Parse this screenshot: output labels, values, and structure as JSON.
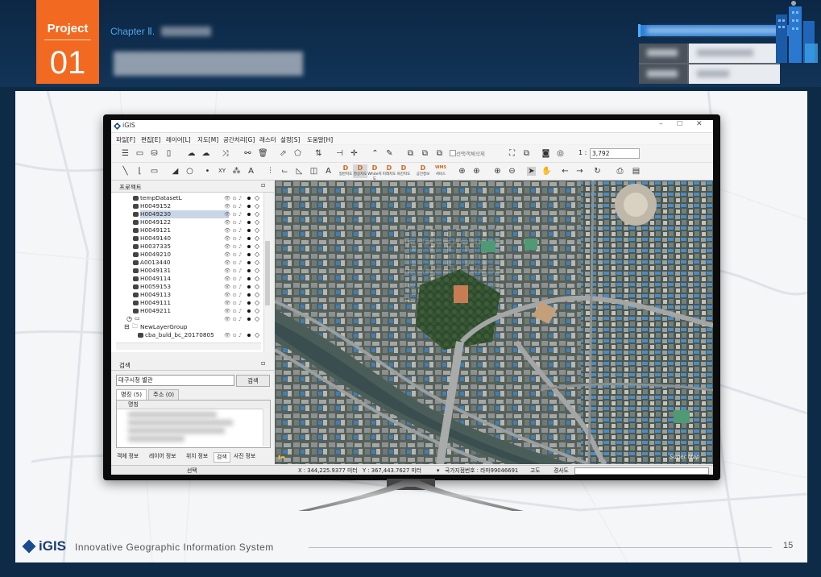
{
  "header": {
    "badge_top": "Project",
    "badge_number": "01",
    "chapter": "Chapter Ⅱ."
  },
  "colors": {
    "accent_orange": "#f26a21",
    "header_bg": "#0d2a47",
    "chapter_blue": "#4da6e8"
  },
  "app": {
    "title": "iGIS",
    "menus": [
      "파일[F]",
      "편집[E]",
      "레이어[L]",
      "지도[M]",
      "공간처리[G]",
      "래스터",
      "설정[S]",
      "도움말[H]"
    ],
    "toolbar_checkbox_label": "선택객체삭제",
    "scale_prefix": "1 :",
    "scale_value": "3,792",
    "map_tool_labels": [
      {
        "name": "일반지도",
        "icon": "D"
      },
      {
        "name": "영상지도",
        "icon": "D"
      },
      {
        "name": "White지도",
        "icon": "D"
      },
      {
        "name": "미래지도",
        "icon": "D"
      },
      {
        "name": "야간지도",
        "icon": "D"
      },
      {
        "name": "공간정보",
        "icon": "D"
      },
      {
        "name": "서비스",
        "icon": "WMS"
      }
    ],
    "project_panel_title": "프로젝트",
    "tree_items": [
      "tempDatasetL",
      "H0049152",
      "H0049230",
      "H0049122",
      "H0049121",
      "H0049140",
      "H0037335",
      "H0049210",
      "A0013440",
      "H0049131",
      "H0049114",
      "H0059153",
      "H0049113",
      "H0049111",
      "H0049211",
      "",
      "NewLayerGroup",
      "cba_buld_bc_20170805"
    ],
    "search_panel_title": "검색",
    "search_value": "대구시청 별관",
    "search_button": "검색",
    "search_tabs": [
      "명칭 (5)",
      "주소 (0)"
    ],
    "result_column": "명칭",
    "bottom_tabs": [
      "객체 정보",
      "레이어 정보",
      "위치 정보",
      "검색",
      "사진 정보"
    ],
    "status": {
      "mode": "선택",
      "x": "X : 344,225.9377 미터",
      "y": "Y : 367,443.7627 미터",
      "grid": "국가지점번호 : 라마99046691",
      "altitude": "고도",
      "slope": "경사도"
    },
    "map_watermark": "Super Map"
  },
  "footer": {
    "logo": "iGIS",
    "tagline": "Innovative Geographic Information System",
    "page_number": "15"
  }
}
